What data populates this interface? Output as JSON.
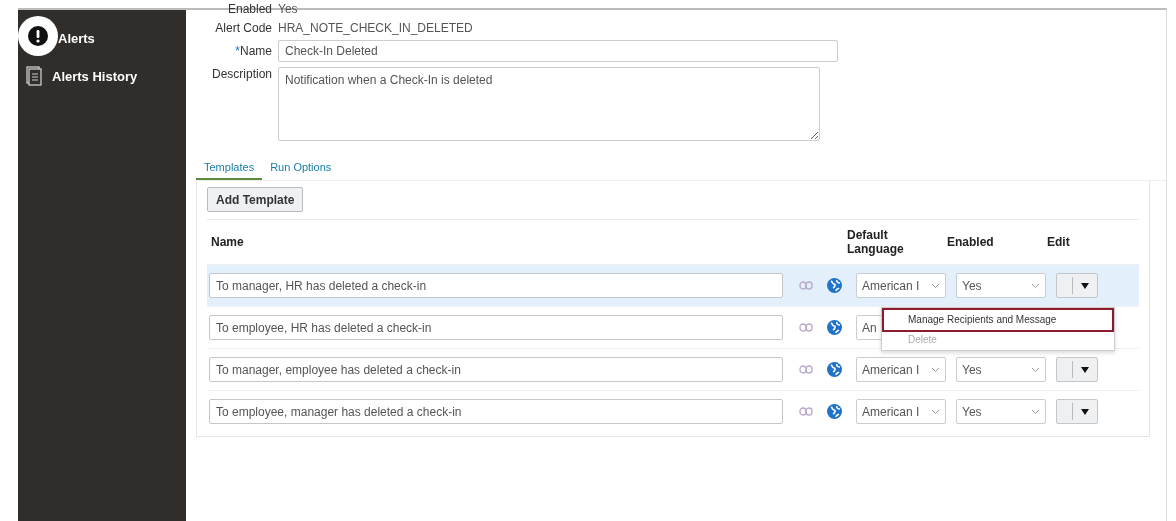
{
  "sidebar": {
    "items": [
      {
        "label": "Alerts",
        "kind": "alert",
        "selected": true
      },
      {
        "label": "Alerts History",
        "kind": "history",
        "selected": false
      }
    ]
  },
  "form": {
    "enabled_label": "Enabled",
    "enabled_value": "Yes",
    "code_label": "Alert Code",
    "code_value": "HRA_NOTE_CHECK_IN_DELETED",
    "required_mark": "*",
    "name_label": "Name",
    "name_value": "Check-In Deleted",
    "description_label": "Description",
    "description_value": "Notification when a Check-In is deleted"
  },
  "tabs": [
    {
      "label": "Templates",
      "selected": true
    },
    {
      "label": "Run Options",
      "selected": false
    }
  ],
  "add_button": "Add Template",
  "table": {
    "columns": [
      "Name",
      "Default Language",
      "Enabled",
      "Edit"
    ],
    "rows": [
      {
        "name": "To manager, HR has deleted a check-in",
        "language": "American I",
        "enabled": "Yes",
        "selected": true
      },
      {
        "name": "To employee, HR has deleted a check-in",
        "language": "An",
        "selected": false
      },
      {
        "name": "To manager, employee has deleted a check-in",
        "language": "American I",
        "enabled": "Yes",
        "selected": false
      },
      {
        "name": "To employee, manager has deleted a check-in",
        "language": "American I",
        "enabled": "Yes",
        "selected": false
      }
    ]
  },
  "menu": {
    "items": [
      {
        "label": "Manage Recipients and Message",
        "selected": true,
        "disabled": false
      },
      {
        "label": "Delete",
        "selected": false,
        "disabled": true
      }
    ]
  }
}
